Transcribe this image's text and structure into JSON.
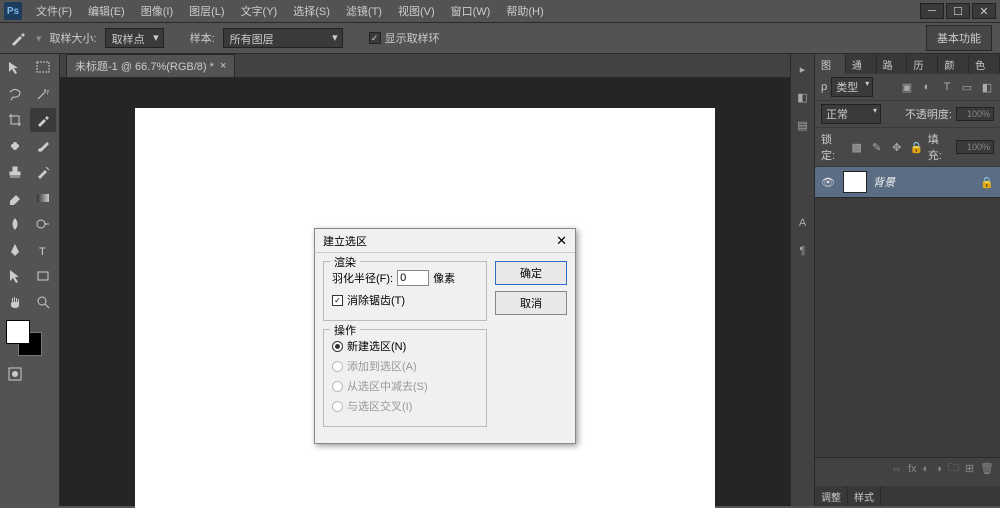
{
  "menu": {
    "file": "文件(F)",
    "edit": "编辑(E)",
    "image": "图像(I)",
    "layer": "图层(L)",
    "type": "文字(Y)",
    "select": "选择(S)",
    "filter": "滤镜(T)",
    "view": "视图(V)",
    "window": "窗口(W)",
    "help": "帮助(H)"
  },
  "options": {
    "sample_size_label": "取样大小:",
    "sample_size_value": "取样点",
    "sample_label": "样本:",
    "sample_value": "所有图层",
    "show_ring_label": "显示取样环",
    "right_label": "基本功能"
  },
  "doc": {
    "tab_title": "未标题-1 @ 66.7%(RGB/8) *"
  },
  "panels": {
    "tabs": {
      "layer": "图层",
      "channel": "通道",
      "path": "路径",
      "history": "历史",
      "action": "色板"
    },
    "extra_tab": "历史",
    "swatch_tab": "颜色",
    "filter_label": "类型",
    "blend_mode": "正常",
    "opacity_label": "不透明度:",
    "opacity_value": "100%",
    "lock_label": "锁定:",
    "fill_label": "填充:",
    "fill_value": "100%",
    "layer_name": "背景",
    "bottom_tabs": {
      "adjust": "调整",
      "style": "样式"
    }
  },
  "dialog": {
    "title": "建立选区",
    "render_legend": "渲染",
    "feather_label": "羽化半径(F):",
    "feather_value": "0",
    "feather_unit": "像素",
    "antialias_label": "消除锯齿(T)",
    "op_legend": "操作",
    "op_new": "新建选区(N)",
    "op_add": "添加到选区(A)",
    "op_sub": "从选区中减去(S)",
    "op_int": "与选区交叉(I)",
    "ok": "确定",
    "cancel": "取消"
  }
}
